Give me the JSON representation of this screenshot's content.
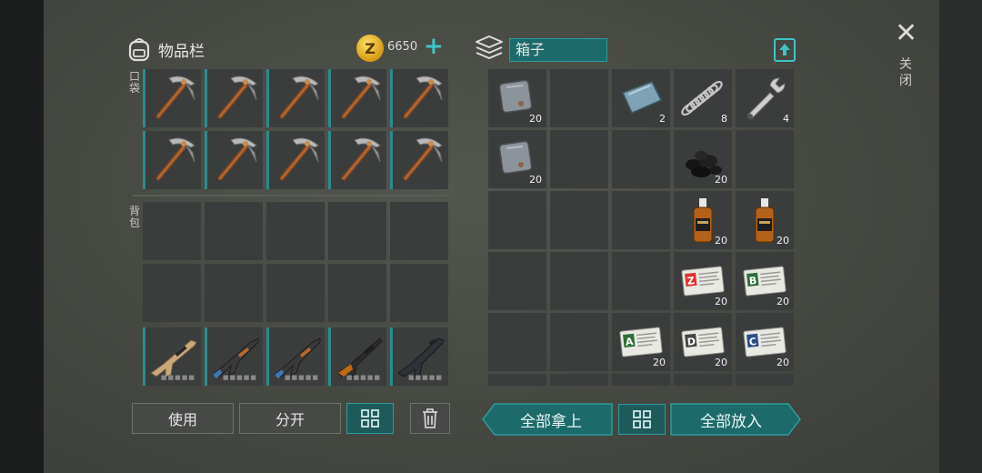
{
  "inventory": {
    "title": "物品栏",
    "coins": "6650",
    "pocket_label": "口袋",
    "backpack_label": "背包",
    "pocket_items": [
      {
        "icon": "pickaxe-icon"
      },
      {
        "icon": "pickaxe-icon"
      },
      {
        "icon": "pickaxe-icon"
      },
      {
        "icon": "pickaxe-icon"
      },
      {
        "icon": "pickaxe-icon"
      },
      {
        "icon": "pickaxe-icon"
      },
      {
        "icon": "pickaxe-icon"
      },
      {
        "icon": "pickaxe-icon"
      },
      {
        "icon": "pickaxe-icon"
      },
      {
        "icon": "pickaxe-icon"
      }
    ],
    "weapons": [
      {
        "icon": "scar-rifle-icon"
      },
      {
        "icon": "ak-rifle-icon"
      },
      {
        "icon": "ak-rifle-icon"
      },
      {
        "icon": "hunting-rifle-icon"
      },
      {
        "icon": "m16-rifle-icon"
      }
    ],
    "buttons": {
      "use": "使用",
      "split": "分开"
    }
  },
  "box": {
    "title": "箱子",
    "items": [
      {
        "icon": "metal-plate-icon",
        "count": "20"
      },
      {
        "icon": "steel-sheet-icon",
        "count": "2"
      },
      {
        "icon": "spring-icon",
        "count": "8"
      },
      {
        "icon": "wrench-icon",
        "count": "4"
      },
      {
        "icon": "metal-plate-icon",
        "count": "20"
      },
      {
        "icon": "coal-icon",
        "count": "20"
      },
      {
        "icon": "whiskey-bottle-icon",
        "count": "20"
      },
      {
        "icon": "whiskey-bottle-icon",
        "count": "20"
      },
      {
        "icon": "ammo-card-z-icon",
        "count": "20",
        "letter": "Z"
      },
      {
        "icon": "ammo-card-b-icon",
        "count": "20",
        "letter": "B"
      },
      {
        "icon": "ammo-card-a-icon",
        "count": "20",
        "letter": "A"
      },
      {
        "icon": "ammo-card-d-icon",
        "count": "20",
        "letter": "D"
      },
      {
        "icon": "ammo-card-c-icon",
        "count": "20",
        "letter": "C"
      }
    ],
    "buttons": {
      "take_all": "全部拿上",
      "put_all": "全部放入"
    }
  },
  "close_label": "关闭",
  "colors": {
    "accent": "#2e9a9b",
    "slot": "#3a3d3c",
    "coin": "#e8b020"
  }
}
